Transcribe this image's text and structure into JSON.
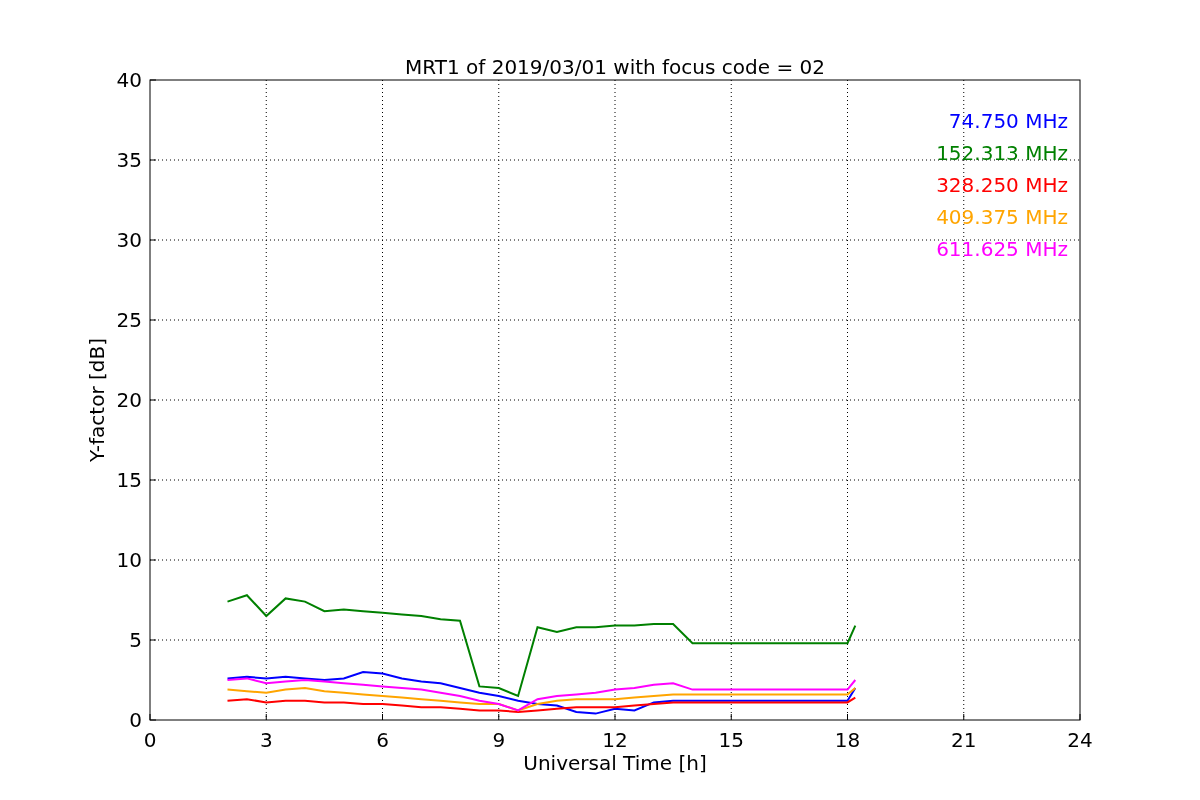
{
  "chart_data": {
    "type": "line",
    "grid": true,
    "title": "MRT1 of 2019/03/01 with focus code = 02",
    "xlabel": "Universal Time [h]",
    "ylabel": "Y-factor [dB]",
    "xlim": [
      0,
      24
    ],
    "ylim": [
      0,
      40
    ],
    "xticks": [
      0,
      3,
      6,
      9,
      12,
      15,
      18,
      21,
      24
    ],
    "yticks": [
      0,
      5,
      10,
      15,
      20,
      25,
      30,
      35,
      40
    ],
    "x": [
      2,
      2.5,
      3,
      3.5,
      4,
      4.5,
      5,
      5.5,
      6,
      6.5,
      7,
      7.5,
      8,
      8.5,
      9,
      9.5,
      10,
      10.5,
      11,
      11.5,
      12,
      12.5,
      13,
      13.5,
      14,
      18,
      18.2
    ],
    "series": [
      {
        "name": "74.750 MHz",
        "color": "#0000ff",
        "values": [
          2.6,
          2.7,
          2.6,
          2.7,
          2.6,
          2.5,
          2.6,
          3.0,
          2.9,
          2.6,
          2.4,
          2.3,
          2.0,
          1.7,
          1.5,
          1.2,
          1.0,
          0.9,
          0.5,
          0.4,
          0.7,
          0.6,
          1.1,
          1.2,
          1.2,
          1.2,
          2.0
        ]
      },
      {
        "name": "152.313 MHz",
        "color": "#008000",
        "values": [
          7.4,
          7.8,
          6.5,
          7.6,
          7.4,
          6.8,
          6.9,
          6.8,
          6.7,
          6.6,
          6.5,
          6.3,
          6.2,
          2.1,
          2.0,
          1.5,
          5.8,
          5.5,
          5.8,
          5.8,
          5.9,
          5.9,
          6.0,
          6.0,
          4.8,
          4.8,
          5.9
        ]
      },
      {
        "name": "328.250 MHz",
        "color": "#ff0000",
        "values": [
          1.2,
          1.3,
          1.1,
          1.2,
          1.2,
          1.1,
          1.1,
          1.0,
          1.0,
          0.9,
          0.8,
          0.8,
          0.7,
          0.6,
          0.6,
          0.5,
          0.6,
          0.7,
          0.8,
          0.8,
          0.8,
          0.9,
          1.0,
          1.1,
          1.1,
          1.1,
          1.4
        ]
      },
      {
        "name": "409.375 MHz",
        "color": "#ffa500",
        "values": [
          1.9,
          1.8,
          1.7,
          1.9,
          2.0,
          1.8,
          1.7,
          1.6,
          1.5,
          1.4,
          1.3,
          1.2,
          1.1,
          1.0,
          1.0,
          0.6,
          1.0,
          1.2,
          1.3,
          1.3,
          1.3,
          1.4,
          1.5,
          1.6,
          1.6,
          1.6,
          2.0
        ]
      },
      {
        "name": "611.625 MHz",
        "color": "#ff00ff",
        "values": [
          2.5,
          2.6,
          2.3,
          2.4,
          2.5,
          2.4,
          2.3,
          2.2,
          2.1,
          2.0,
          1.9,
          1.7,
          1.5,
          1.2,
          1.0,
          0.6,
          1.3,
          1.5,
          1.6,
          1.7,
          1.9,
          2.0,
          2.2,
          2.3,
          1.9,
          1.9,
          2.5
        ]
      }
    ]
  }
}
